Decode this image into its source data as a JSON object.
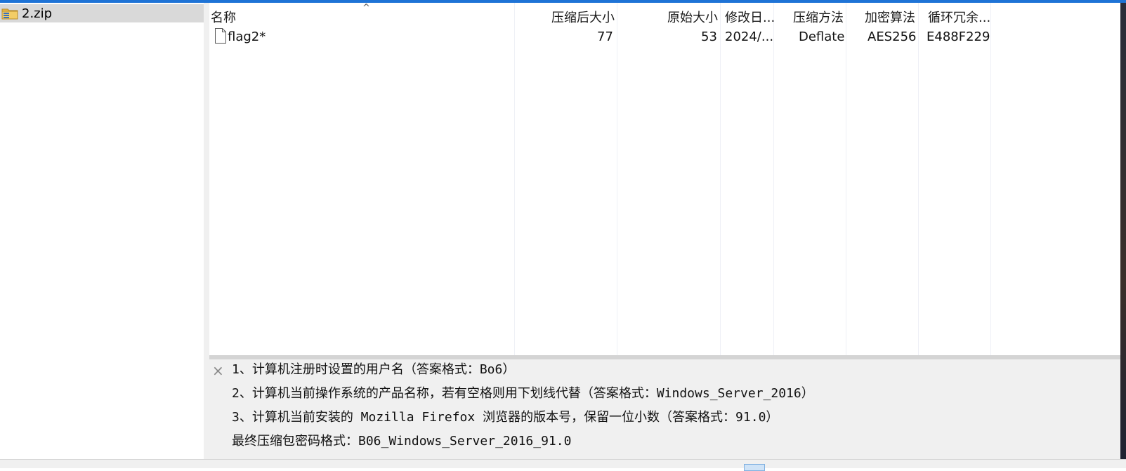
{
  "tree": {
    "item_label": "2.zip",
    "item_icon": "zip-folder-icon"
  },
  "list": {
    "columns": [
      {
        "key": "name",
        "label": "名称"
      },
      {
        "key": "packed",
        "label": "压缩后大小"
      },
      {
        "key": "original",
        "label": "原始大小"
      },
      {
        "key": "modified",
        "label": "修改日..."
      },
      {
        "key": "method",
        "label": "压缩方法"
      },
      {
        "key": "encryption",
        "label": "加密算法"
      },
      {
        "key": "crc",
        "label": "循环冗余..."
      }
    ],
    "sort_indicator": "^",
    "rows": [
      {
        "name": "flag2*",
        "packed": "77",
        "original": "53",
        "modified": "2024/...",
        "method": "Deflate",
        "encryption": "AES256",
        "crc": "E488F229",
        "icon": "file-icon"
      }
    ]
  },
  "comment": {
    "close_symbol": "×",
    "lines": [
      "1、计算机注册时设置的用户名（答案格式：Bo6）",
      "2、计算机当前操作系统的产品名称，若有空格则用下划线代替（答案格式：Windows_Server_2016）",
      "3、计算机当前安装的 Mozilla Firefox 浏览器的版本号，保留一位小数（答案格式：91.0）",
      "最终压缩包密码格式：B06_Windows_Server_2016_91.0"
    ]
  },
  "colors": {
    "accent": "#1e73d6",
    "selected_row": "#d9d9d9",
    "comment_bg": "#f0f0f0"
  }
}
